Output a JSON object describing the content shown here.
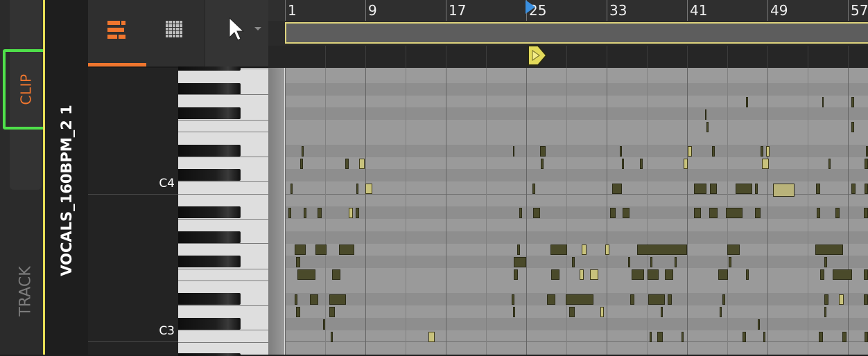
{
  "vertical_tabs": {
    "clip_label": "CLIP",
    "track_label": "TRACK"
  },
  "clip_name": "VOCALS_160BPM_2 1",
  "toolbar": {
    "pianoroll_icon": "piano-roll-icon",
    "grid_icon": "grid-icon",
    "tool_icon": "pointer-tool-icon",
    "tool_dropdown_icon": "chevron-down-icon"
  },
  "ruler": {
    "bars": [
      "1",
      "9",
      "17",
      "25",
      "33",
      "41",
      "49",
      "57"
    ]
  },
  "keyboard": {
    "c4_label": "C4",
    "c3_label": "C3"
  },
  "colors": {
    "accent": "#f0762e",
    "highlight": "#4fe04a",
    "clip_yellow": "#e6dd55",
    "note_dark": "#4a4a2a",
    "note_selected": "#c8c27c"
  }
}
